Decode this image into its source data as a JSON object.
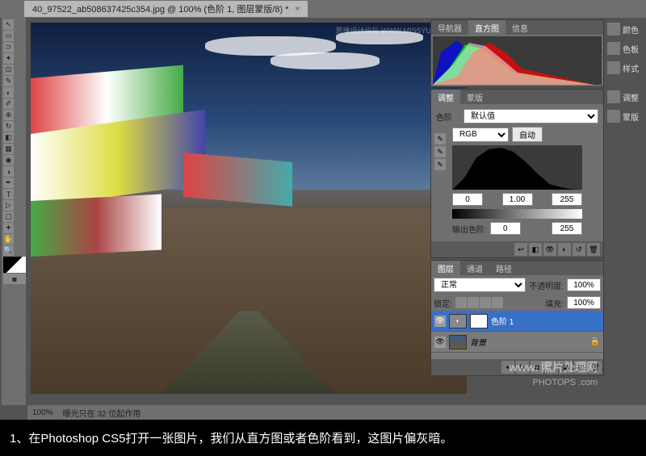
{
  "document": {
    "tab_title": "40_97522_ab508637425c354.jpg @ 100% (色阶 1, 图层蒙版/8) *"
  },
  "watermarks": {
    "top": "思缘设计论坛 WWW.MISSYUAN.COM",
    "bottom_logo": "www. 照片处理网",
    "bottom_url": "PHOTOPS .com"
  },
  "status": {
    "zoom": "100%",
    "info": "曝光只在 32 位起作用"
  },
  "panels": {
    "histogram": {
      "tabs": [
        "导航器",
        "直方图",
        "信息"
      ],
      "active": 1
    },
    "adjustments": {
      "tabs": [
        "调整",
        "蒙版"
      ],
      "active": 0,
      "type_label": "色阶",
      "preset": "默认值",
      "channel": "RGB",
      "auto_btn": "自动",
      "input_black": "0",
      "input_mid": "1.00",
      "input_white": "255",
      "output_label": "输出色阶:",
      "output_black": "0",
      "output_white": "255"
    },
    "layers": {
      "tabs": [
        "图层",
        "通道",
        "路径"
      ],
      "active": 0,
      "blend_mode": "正常",
      "opacity_label": "不透明度:",
      "opacity": "100%",
      "lock_label": "锁定:",
      "fill_label": "填充:",
      "fill": "100%",
      "items": [
        {
          "name": "色阶 1",
          "selected": true,
          "has_mask": true
        },
        {
          "name": "背景",
          "selected": false,
          "has_mask": false
        }
      ]
    }
  },
  "side_panels": {
    "color": "颜色",
    "swatches": "色板",
    "styles": "样式",
    "adjustments": "调整",
    "masks": "蒙版"
  },
  "caption": "1、在Photoshop CS5打开一张图片，我们从直方图或者色阶看到，这图片偏灰暗。"
}
